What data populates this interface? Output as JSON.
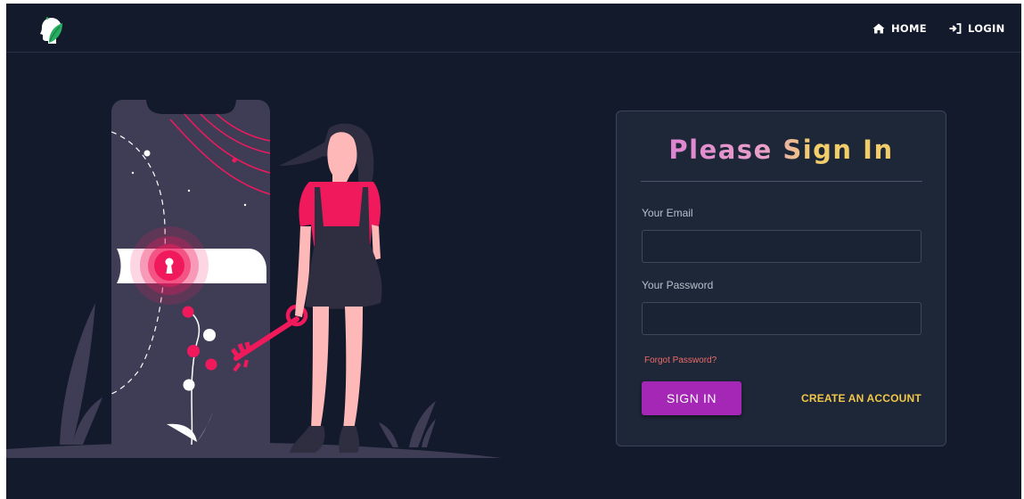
{
  "colors": {
    "background": "#121a2b",
    "card": "#1d2737",
    "accent_button": "#a427b5",
    "link_forgot": "#f06a6a",
    "link_create": "#f2c74a",
    "illustration_pink": "#f0195c"
  },
  "navbar": {
    "logo_icon": "head-leaf-logo-icon",
    "home": {
      "label": "HOME",
      "icon": "home-icon"
    },
    "login": {
      "label": "LOGIN",
      "icon": "sign-in-icon"
    }
  },
  "login_form": {
    "title": "Please Sign In",
    "email": {
      "label": "Your Email",
      "value": "",
      "placeholder": ""
    },
    "password": {
      "label": "Your Password",
      "value": "",
      "placeholder": ""
    },
    "forgot_password": "Forgot Password?",
    "sign_in_button": "SIGN IN",
    "create_account": "CREATE AN ACCOUNT"
  }
}
